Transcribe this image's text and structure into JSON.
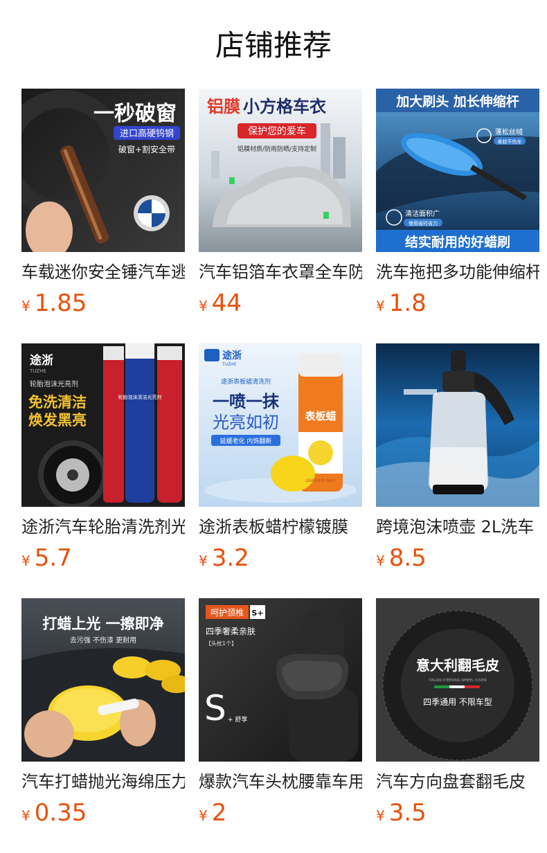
{
  "page": {
    "title": "店铺推荐"
  },
  "currency_symbol": "¥",
  "colors": {
    "price": "#e8500a",
    "title": "#111111",
    "text": "#222222"
  },
  "products": [
    {
      "name": "车载迷你安全锤汽车逃生锤",
      "price": "1.85",
      "image": {
        "icon": "safety-hammer-icon",
        "headline": "一秒破窗",
        "badge": "进口高硬钨钢",
        "note": "破窗+割安全带"
      }
    },
    {
      "name": "汽车铝箔车衣罩全车防晒",
      "price": "44",
      "image": {
        "icon": "car-cover-icon",
        "headline_a": "铝膜",
        "headline_b": "小方格车衣",
        "badge": "保护您的爱车",
        "note": "铝膜材质/防雨防晒/支持定制"
      }
    },
    {
      "name": "洗车拖把多功能伸缩杆",
      "price": "1.8",
      "image": {
        "icon": "car-mop-icon",
        "headline": "加大刷头 加长伸缩杆",
        "tag_top": "蓬松丝绒",
        "tag_top_sub": "柔软不伤车",
        "tag_mid": "清洁面积广",
        "tag_mid_sub": "使用省时省力",
        "footer": "结实耐用的好蜡刷"
      }
    },
    {
      "name": "途浙汽车轮胎清洗剂光亮剂",
      "price": "5.7",
      "image": {
        "icon": "tire-cleaner-icon",
        "brand": "途浙",
        "brand_sub": "TUZHE",
        "subtitle": "轮胎泡沫光亮剂",
        "line1": "免洗清洁",
        "line2": "焕发黑亮",
        "can_label": "轮胎泡沫清洁光亮剂"
      }
    },
    {
      "name": "途浙表板蜡柠檬镀膜",
      "price": "3.2",
      "image": {
        "icon": "dashboard-wax-icon",
        "brand": "途浙",
        "brand_sub": "TUZHE",
        "subtitle": "途浙表板蜡清洗剂",
        "line1": "一喷一抹",
        "line2": "光亮如初",
        "badge": "延缓老化 内饰翻新",
        "can_label": "表板蜡",
        "can_sub": "LEATHER WAX"
      }
    },
    {
      "name": "跨境泡沫喷壶 2L洗车",
      "price": "8.5",
      "image": {
        "icon": "foam-sprayer-icon"
      }
    },
    {
      "name": "汽车打蜡抛光海绵压力棉",
      "price": "0.35",
      "image": {
        "icon": "wax-sponge-icon",
        "headline": "打蜡上光 一擦即净",
        "note": "去污强 不伤漆 更耐用"
      }
    },
    {
      "name": "爆款汽车头枕腰靠车用",
      "price": "2",
      "image": {
        "icon": "headrest-pillow-icon",
        "tag": "呵护颈椎",
        "tag_grade": "S+",
        "line1": "四季奢柔亲肤",
        "line2": "【头枕1个】",
        "big_letter": "S",
        "big_sub": "+ 舒享"
      }
    },
    {
      "name": "汽车方向盘套翻毛皮",
      "price": "3.5",
      "image": {
        "icon": "steering-wheel-cover-icon",
        "headline": "意大利翻毛皮",
        "small": "ITALIAN STEERING WHEEL COVER",
        "note": "四季通用 不限车型"
      }
    }
  ]
}
